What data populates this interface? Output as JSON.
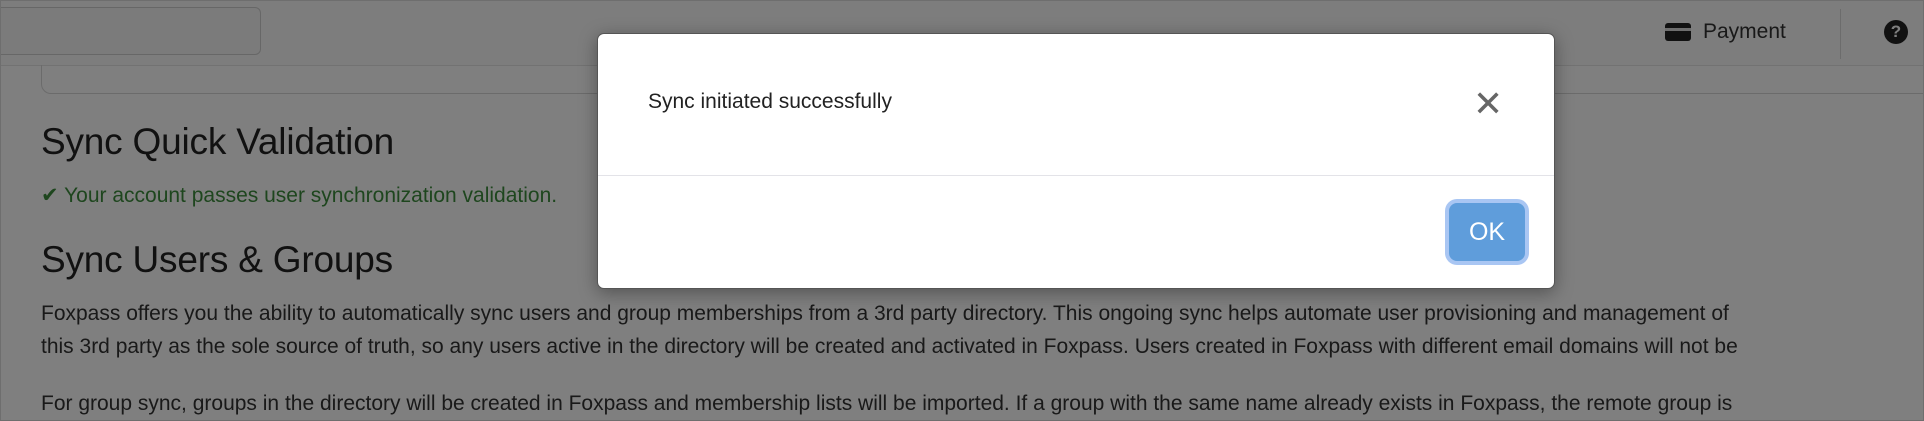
{
  "topbar": {
    "payment_label": "Payment",
    "payment_icon": "credit-card-icon",
    "help_icon": "question-circle-icon",
    "help_glyph": "?"
  },
  "content": {
    "validation_heading": "Sync Quick Validation",
    "validation_icon": "checkmark-icon",
    "validation_message": "Your account passes user synchronization validation.",
    "groups_heading": "Sync Users & Groups",
    "paragraph1": "Foxpass offers you the ability to automatically sync users and group memberships from a 3rd party directory. This ongoing sync helps automate user provisioning and management of",
    "paragraph1_cont": "this 3rd party as the sole source of truth, so any users active in the directory will be created and activated in Foxpass. Users created in Foxpass with different email domains will not be",
    "paragraph2": "For group sync, groups in the directory will be created in Foxpass and membership lists will be imported. If a group with the same name already exists in Foxpass, the remote group is"
  },
  "modal": {
    "message": "Sync initiated successfully",
    "close_glyph": "✕",
    "close_icon": "close-icon",
    "ok_label": "OK"
  },
  "colors": {
    "success_green": "#3c8c3c",
    "ok_button": "#5f9ddb",
    "overlay": "rgba(0,0,0,0.5)"
  }
}
